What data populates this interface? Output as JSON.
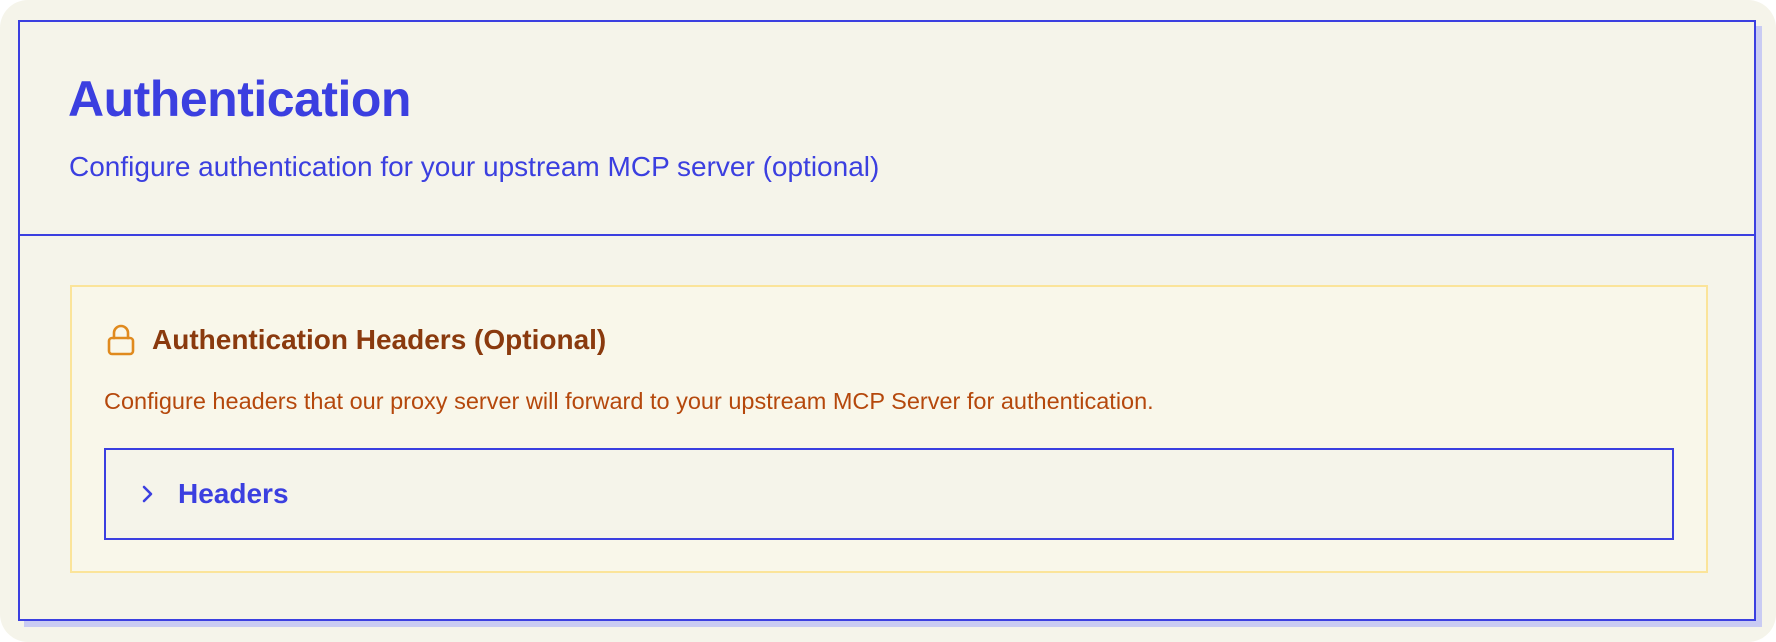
{
  "section": {
    "title": "Authentication",
    "subtitle": "Configure authentication for your upstream MCP server (optional)"
  },
  "auth_notice": {
    "icon": "lock-icon",
    "title": "Authentication Headers (Optional)",
    "description": "Configure headers that our proxy server will forward to your upstream MCP Server for authentication."
  },
  "headers_panel": {
    "icon": "chevron-right-icon",
    "label": "Headers",
    "expanded": false
  },
  "colors": {
    "accent": "#3b3fe0",
    "background": "#f5f4ea",
    "warning_border": "#fbe49a",
    "warning_title": "#8a3a0e",
    "warning_text": "#b5480c",
    "warning_icon": "#e08a1e"
  }
}
